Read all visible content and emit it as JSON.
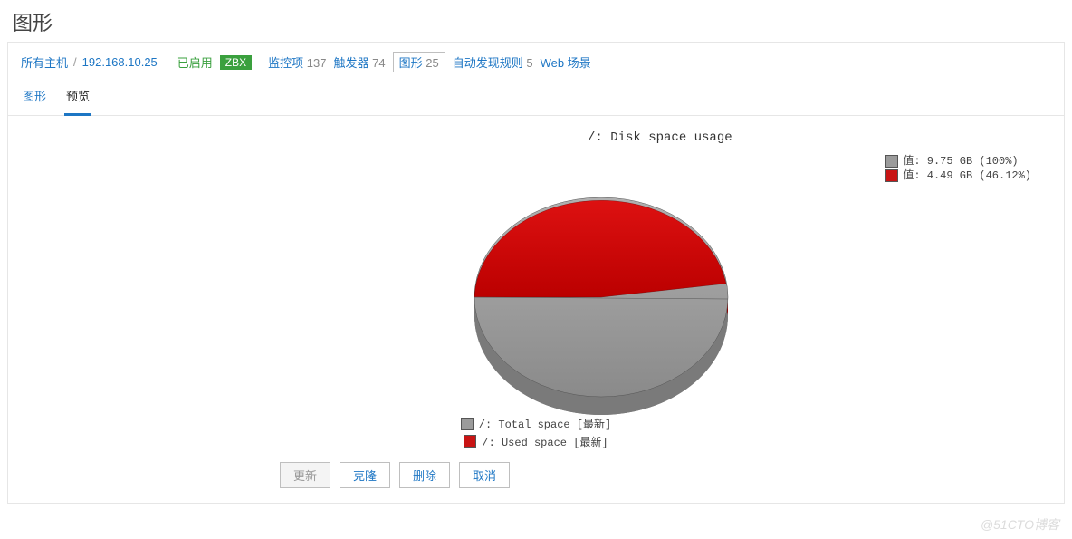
{
  "page_title": "图形",
  "breadcrumb": {
    "all_hosts": "所有主机",
    "host_ip": "192.168.10.25",
    "enabled": "已启用",
    "zbx_badge": "ZBX",
    "items": [
      {
        "label": "监控项",
        "count": "137"
      },
      {
        "label": "触发器",
        "count": "74"
      },
      {
        "label": "图形",
        "count": "25",
        "active": true
      },
      {
        "label": "自动发现规则",
        "count": "5"
      },
      {
        "label": "Web 场景",
        "count": ""
      }
    ]
  },
  "tabs": {
    "graph": "图形",
    "preview": "预览"
  },
  "buttons": {
    "update": "更新",
    "clone": "克隆",
    "delete": "删除",
    "cancel": "取消"
  },
  "watermark": "@51CTO博客",
  "chart_data": {
    "type": "pie",
    "title": "/: Disk space usage",
    "series": [
      {
        "name": "/: Total space",
        "color": "#9b9b9b",
        "value_gb": 9.75,
        "percent": 100,
        "legend_right": "值: 9.75 GB (100%)",
        "legend_bottom": "/: Total space   [最新]"
      },
      {
        "name": "/: Used space",
        "color": "#c81414",
        "value_gb": 4.49,
        "percent": 46.12,
        "legend_right": "值: 4.49 GB (46.12%)",
        "legend_bottom": "/: Used space    [最新]"
      }
    ]
  }
}
